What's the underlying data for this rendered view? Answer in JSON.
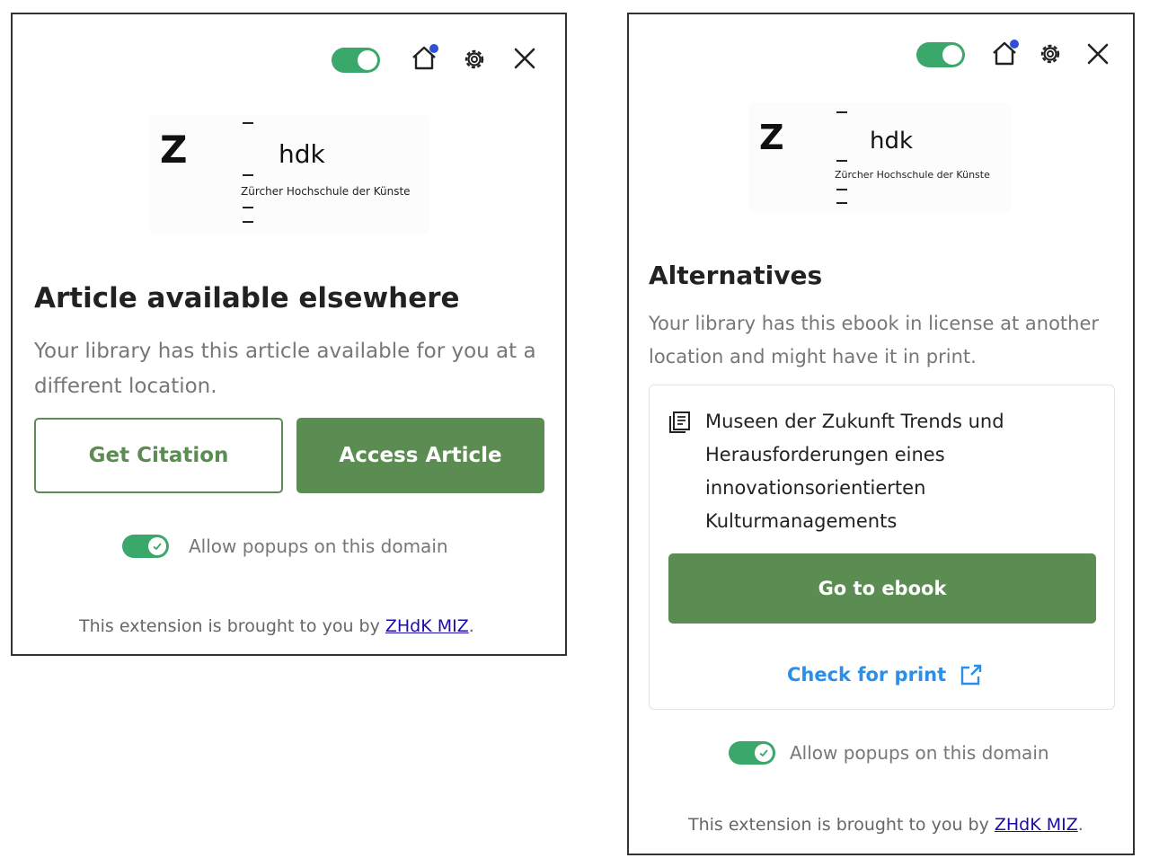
{
  "colors": {
    "brand_green": "#5b8c51",
    "toggle_green": "#3aa86b",
    "link_blue": "#2b8ee8",
    "footer_link": "#1a0dab",
    "notification_dot": "#2f4fd8"
  },
  "toolbar_icons": [
    "play-toggle",
    "home-icon",
    "gear-icon",
    "close-icon"
  ],
  "logo": {
    "mark": "Z",
    "name": "hdk",
    "subtitle": "Zürcher Hochschule der Künste"
  },
  "left_panel": {
    "title": "Article available elsewhere",
    "description": "Your library has this article available for you at a different location.",
    "get_citation_label": "Get Citation",
    "access_article_label": "Access Article",
    "popup_toggle_label": "Allow popups on this domain",
    "footer_prefix": "This extension is brought to you by ",
    "footer_link": "ZHdK MIZ",
    "footer_suffix": "."
  },
  "right_panel": {
    "title": "Alternatives",
    "description": "Your library has this ebook in license at another location and might have it in print.",
    "book_title": "Museen der Zukunft Trends und Herausforderungen eines innovationsorientierten Kulturmanagements",
    "go_to_ebook_label": "Go to ebook",
    "check_for_print_label": "Check for print",
    "popup_toggle_label": "Allow popups on this domain",
    "footer_prefix": "This extension is brought to you by ",
    "footer_link": "ZHdK MIZ",
    "footer_suffix": "."
  }
}
